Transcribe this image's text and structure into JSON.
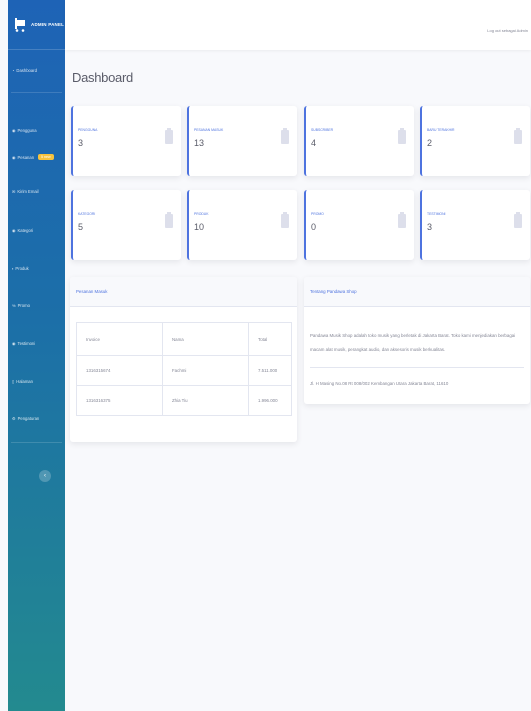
{
  "brand": {
    "name": "ADMIN PANEL"
  },
  "sidebar": {
    "items": [
      {
        "label": "Dashboard",
        "icon": "gauge-icon"
      },
      {
        "label": "Pengguna",
        "icon": "users-icon"
      },
      {
        "label": "Pesanan",
        "icon": "cart-icon",
        "badge": "5 new"
      },
      {
        "label": "Kirim Email",
        "icon": "envelope-icon"
      },
      {
        "label": "Kategori",
        "icon": "tag-icon"
      },
      {
        "label": "Produk",
        "icon": "box-icon"
      },
      {
        "label": "Promo",
        "icon": "percent-icon"
      },
      {
        "label": "Testimoni",
        "icon": "comment-icon"
      },
      {
        "label": "Halaman",
        "icon": "file-icon"
      },
      {
        "label": "Pengaturan",
        "icon": "gear-icon"
      }
    ],
    "toggle_symbol": "‹"
  },
  "topbar": {
    "logout": "Log out sebagai Admin"
  },
  "page": {
    "title": "Dashboard"
  },
  "cards": [
    {
      "label": "PENGGUNA",
      "value": "3"
    },
    {
      "label": "PESANAN MASUK",
      "value": "13"
    },
    {
      "label": "SUBSCRIBER",
      "value": "4"
    },
    {
      "label": "BARU TERAKHIR",
      "value": "2"
    },
    {
      "label": "KATEGORI",
      "value": "5"
    },
    {
      "label": "PRODUK",
      "value": "10"
    },
    {
      "label": "PROMO",
      "value": "0"
    },
    {
      "label": "TESTIMONI",
      "value": "3"
    }
  ],
  "orders": {
    "title": "Pesanan Masuk",
    "headers": [
      "Invoice",
      "Nama",
      "Total"
    ],
    "rows": [
      [
        "1316315674",
        "Fachmi",
        "7.511.000"
      ],
      [
        "1316316375",
        "Zhia Tiu",
        "1.996.000"
      ]
    ]
  },
  "about": {
    "title": "Tentang Pandawa Shop",
    "text": "Pandawa Musik Shop adalah toko musik yang berletak di Jakarta Barat. Toko kami menjediakan berbagai macam alat musik, perangkat audio, dan aksesoris musik berkualitas.",
    "address": "Jl. H Masing No.08 Rt 008/002 Kembangan Utara Jakarta Barat, 11610"
  },
  "colors": {
    "primary": "#4e73df",
    "sidebar_top": "#1e63b6",
    "sidebar_bottom": "#238a8f",
    "badge": "#f6c23e"
  }
}
